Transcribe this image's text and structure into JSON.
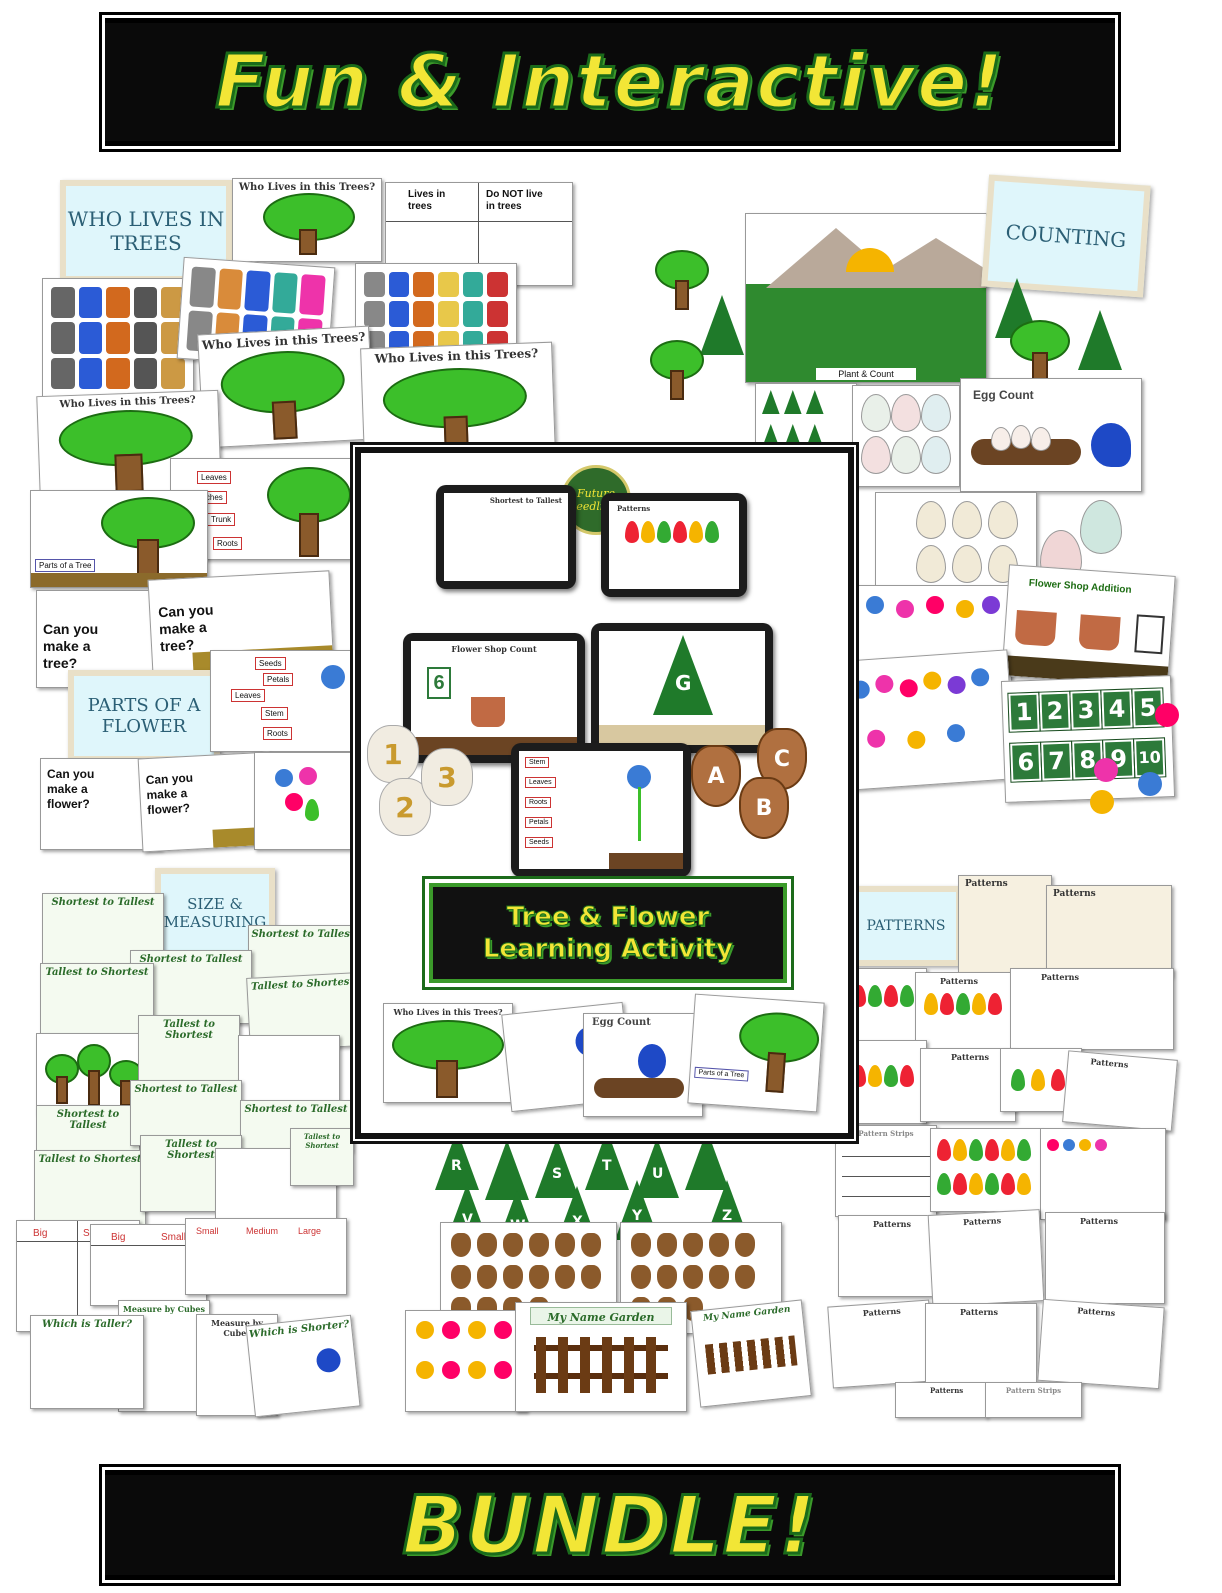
{
  "banners": {
    "top": "Fun & Interactive!",
    "bottom": "BUNDLE!"
  },
  "section_titles": {
    "who_lives": "WHO LIVES IN TREES",
    "counting": "COUNTING",
    "parts_flower": "PARTS OF A FLOWER",
    "size_measuring": "SIZE & MEASURING",
    "patterns": "PATTERNS"
  },
  "cards": {
    "who_lives_title": "Who Lives in this Trees?",
    "lives_in_trees": "Lives in trees",
    "do_not_live": "Do NOT live in trees",
    "plant_count": "Plant & Count",
    "egg_count": "Egg Count",
    "flower_shop_addition": "Flower Shop Addition",
    "make_tree": "Can you make a tree?",
    "make_flower": "Can you make a flower?",
    "shortest_to_tallest": "Shortest to Tallest",
    "tallest_to_shortest": "Tallest to Shortest",
    "my_name_garden": "My Name Garden",
    "patterns_label": "Patterns",
    "pattern_strips": "Pattern Strips",
    "which_taller": "Which is Taller?",
    "which_shorter": "Which is Shorter?",
    "measure_cubes": "Measure by Cubes",
    "small": "Small",
    "medium": "Medium",
    "large": "Large",
    "big": "Big",
    "parts_of_tree": "Parts of a Tree",
    "parts_of_flower": "Parts of a Flower"
  },
  "tree_labels": [
    "Leaves",
    "Branches",
    "Trunk",
    "Roots"
  ],
  "flower_labels": [
    "Seeds",
    "Petals",
    "Leaves",
    "Stem",
    "Roots"
  ],
  "number_tiles": [
    "1",
    "2",
    "3",
    "4",
    "5",
    "6",
    "7",
    "8",
    "9",
    "10"
  ],
  "letters_trees": [
    "R",
    "S",
    "T",
    "U",
    "V",
    "W",
    "X",
    "Y",
    "Z"
  ],
  "cover": {
    "logo": "Future Seedlings",
    "title_line1": "Tree & Flower",
    "title_line2": "Learning Activity",
    "tablet1_title": "Shortest to Tallest",
    "tablet2_title": "Patterns",
    "tablet3_title": "Flower Shop Count",
    "tablet3_number": "6",
    "tablet4_letter": "G",
    "tablet5_labels": [
      "Stem",
      "Leaves",
      "Roots",
      "Petals",
      "Seeds"
    ],
    "stones": [
      "1",
      "2",
      "3"
    ],
    "acorns": [
      "A",
      "B",
      "C"
    ],
    "mini_title": "Who Lives in this Trees?",
    "mini_egg": "Egg Count",
    "mini_parts": "Parts of a Tree"
  },
  "colors": {
    "banner_bg": "#0a0a0a",
    "banner_text": "#f2e636",
    "banner_outline": "#1a6b1a",
    "tree_green": "#3cbf2a",
    "trunk_brown": "#8a5a2b",
    "title_card_bg": "#dff6fb"
  }
}
